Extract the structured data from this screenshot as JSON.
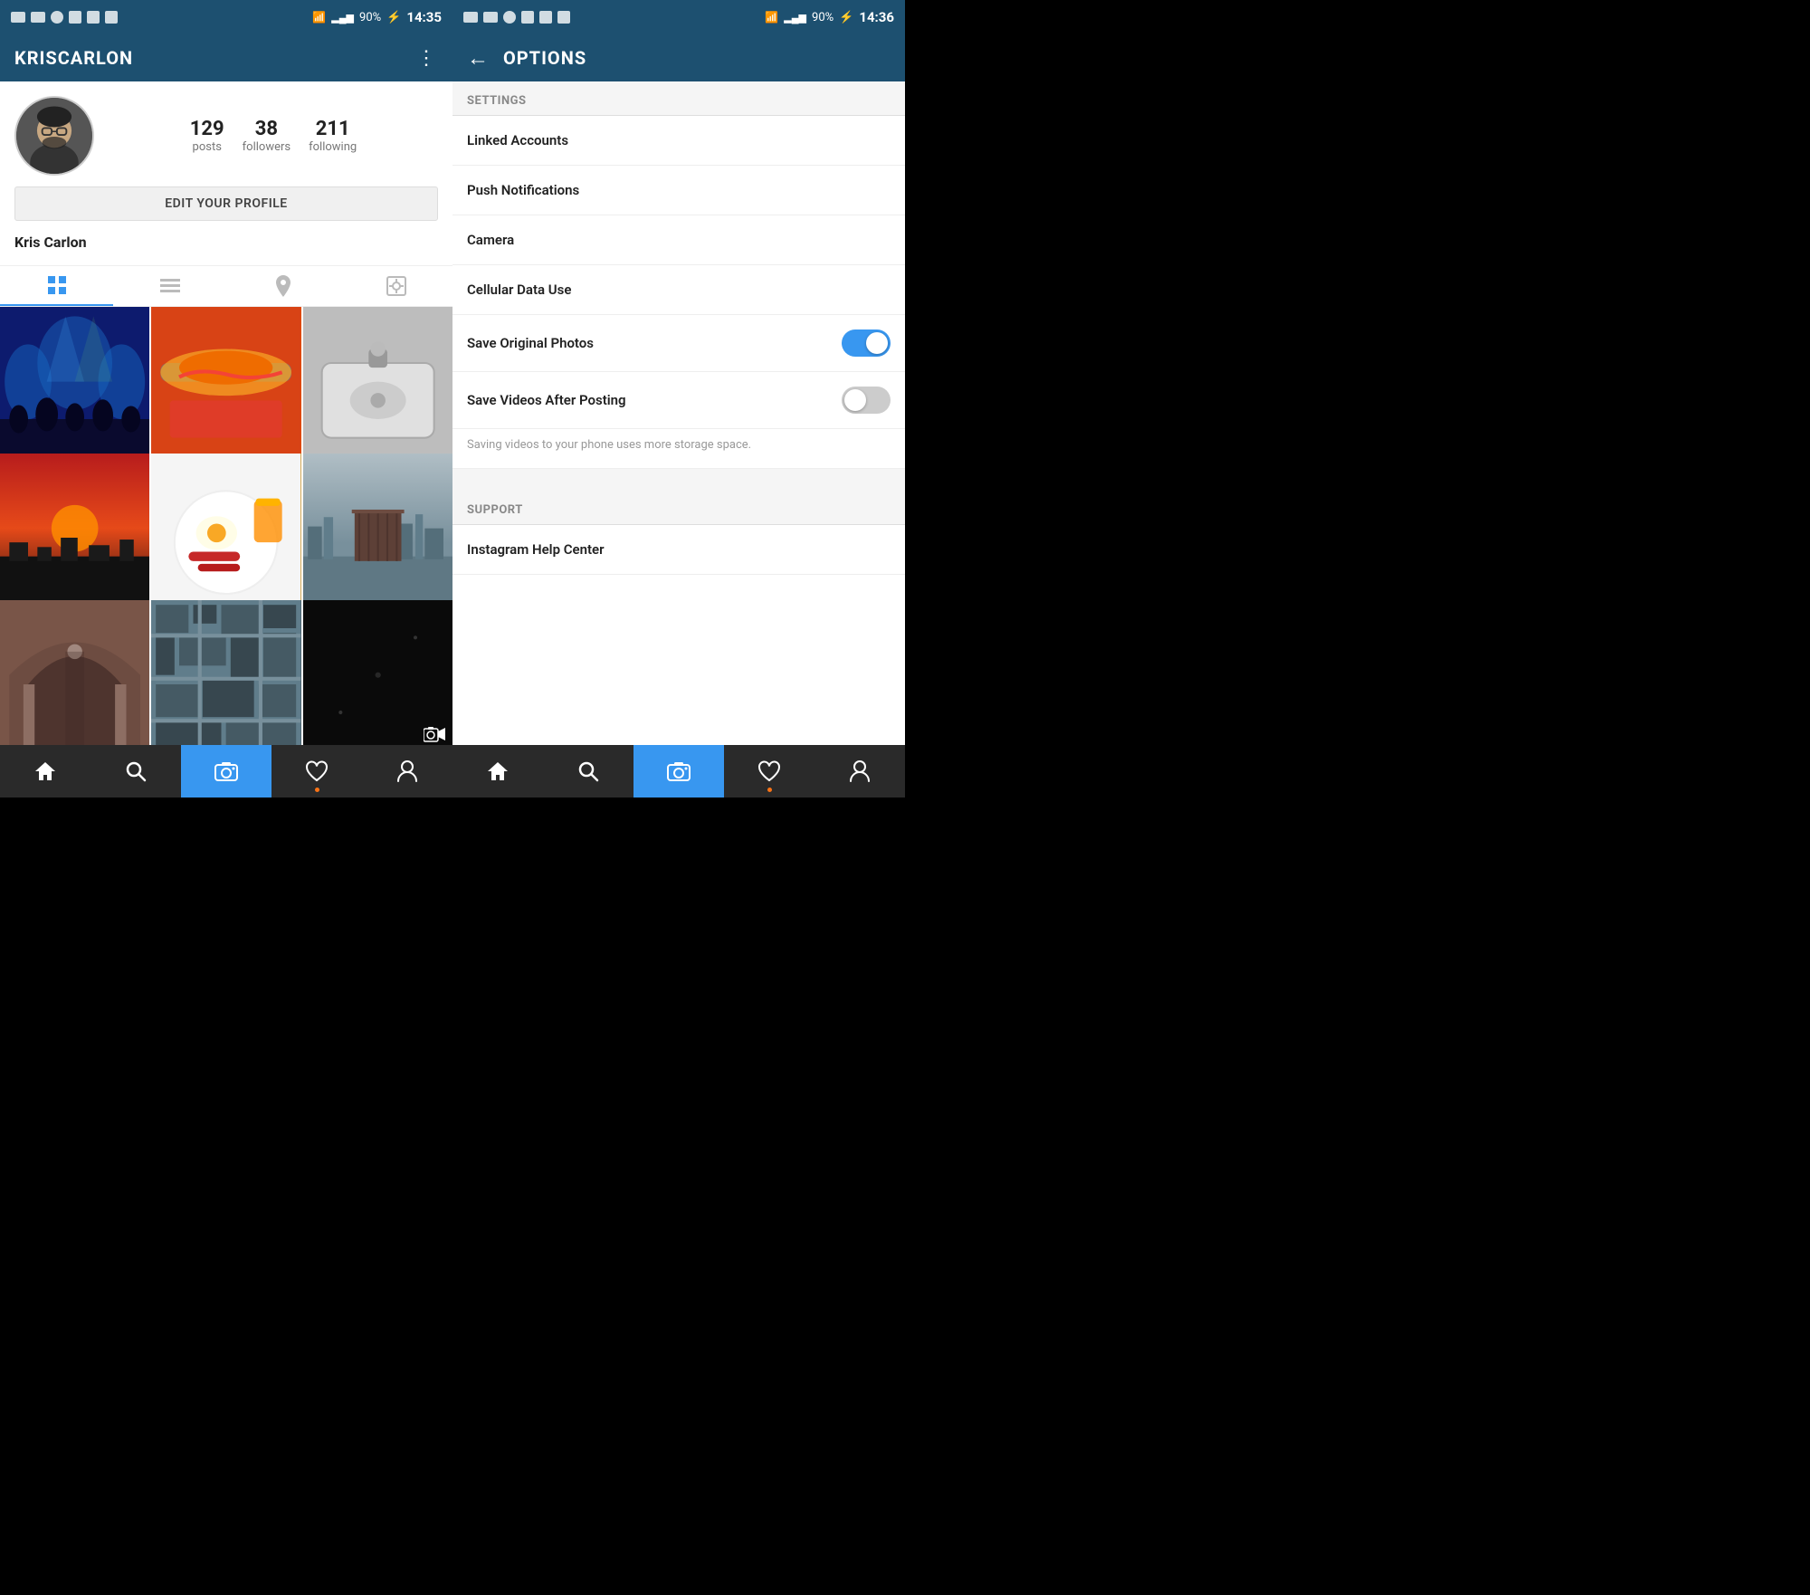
{
  "left": {
    "status_bar": {
      "time": "14:35",
      "battery": "90%"
    },
    "header": {
      "title": "KRISCARLON",
      "menu_label": "⋮"
    },
    "profile": {
      "name": "Kris Carlon",
      "stats": [
        {
          "number": "129",
          "label": "posts"
        },
        {
          "number": "38",
          "label": "followers"
        },
        {
          "number": "211",
          "label": "following"
        }
      ],
      "edit_button": "EDIT YOUR PROFILE"
    },
    "tabs": [
      {
        "id": "grid",
        "label": "⊞",
        "active": true
      },
      {
        "id": "list",
        "label": "≡",
        "active": false
      },
      {
        "id": "location",
        "label": "◎",
        "active": false
      },
      {
        "id": "tagged",
        "label": "⊡",
        "active": false
      }
    ],
    "photos": [
      {
        "id": "concert",
        "color": "#1a237e",
        "type": "concert"
      },
      {
        "id": "food1",
        "color": "#e65100",
        "type": "food"
      },
      {
        "id": "sink",
        "color": "#9e9e9e",
        "type": "bathroom"
      },
      {
        "id": "sunset",
        "color": "#8b1a1a",
        "type": "sunset"
      },
      {
        "id": "food2",
        "color": "#c8860a",
        "type": "breakfast"
      },
      {
        "id": "pier",
        "color": "#4a6a7a",
        "type": "pier"
      },
      {
        "id": "arch",
        "color": "#5d4037",
        "type": "architecture"
      },
      {
        "id": "city",
        "color": "#455a64",
        "type": "cityscape"
      },
      {
        "id": "dark",
        "color": "#111111",
        "type": "dark",
        "has_camera": true
      }
    ],
    "bottom_nav": [
      {
        "id": "home",
        "icon": "⌂",
        "active": false
      },
      {
        "id": "search",
        "icon": "⌕",
        "active": false
      },
      {
        "id": "camera",
        "icon": "◉",
        "active": true
      },
      {
        "id": "heart",
        "icon": "♥",
        "active": false,
        "has_dot": true
      },
      {
        "id": "profile",
        "icon": "👤",
        "active": false
      }
    ]
  },
  "right": {
    "status_bar": {
      "time": "14:36",
      "battery": "90%"
    },
    "header": {
      "back_label": "←",
      "title": "OPTIONS"
    },
    "settings_section_label": "SETTINGS",
    "settings_items": [
      {
        "id": "linked-accounts",
        "label": "Linked Accounts",
        "has_toggle": false
      },
      {
        "id": "push-notifications",
        "label": "Push Notifications",
        "has_toggle": false
      },
      {
        "id": "camera",
        "label": "Camera",
        "has_toggle": false
      },
      {
        "id": "cellular-data",
        "label": "Cellular Data Use",
        "has_toggle": false
      }
    ],
    "toggle_items": [
      {
        "id": "save-original-photos",
        "label": "Save Original Photos",
        "enabled": true
      },
      {
        "id": "save-videos",
        "label": "Save Videos After Posting",
        "enabled": false
      }
    ],
    "helper_text": "Saving videos to your phone uses more storage space.",
    "support_section_label": "SUPPORT",
    "support_items": [
      {
        "id": "help-center",
        "label": "Instagram Help Center"
      }
    ],
    "bottom_nav": [
      {
        "id": "home",
        "icon": "⌂",
        "active": false
      },
      {
        "id": "search",
        "icon": "⌕",
        "active": false
      },
      {
        "id": "camera",
        "icon": "◉",
        "active": true
      },
      {
        "id": "heart",
        "icon": "♥",
        "active": false,
        "has_dot": true
      },
      {
        "id": "profile",
        "icon": "👤",
        "active": false
      }
    ]
  }
}
